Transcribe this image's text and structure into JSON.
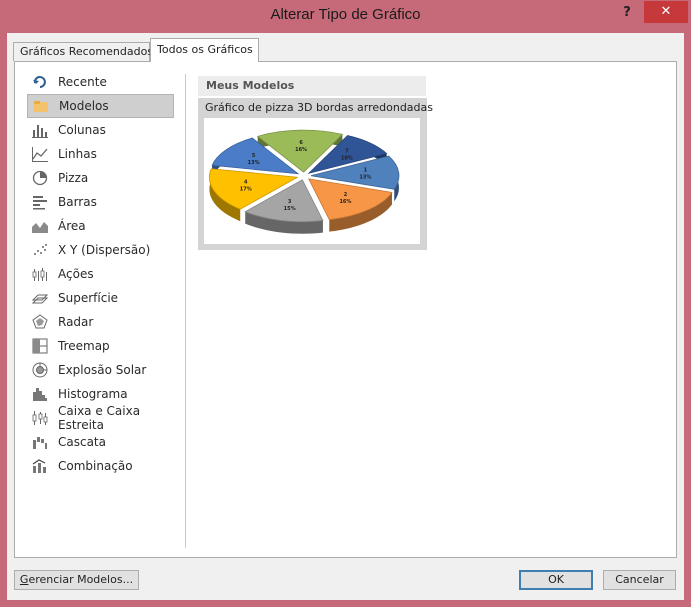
{
  "window": {
    "title": "Alterar Tipo de Gráfico",
    "help_label": "?",
    "close_label": "✕"
  },
  "tabs": [
    {
      "label": "Gráficos Recomendados",
      "active": false
    },
    {
      "label": "Todos os Gráficos",
      "active": true
    }
  ],
  "sidebar": {
    "selected": "Modelos",
    "items": [
      {
        "label": "Recente",
        "icon": "recent-icon"
      },
      {
        "label": "Modelos",
        "icon": "folder-icon"
      },
      {
        "label": "Colunas",
        "icon": "column-chart-icon"
      },
      {
        "label": "Linhas",
        "icon": "line-chart-icon"
      },
      {
        "label": "Pizza",
        "icon": "pie-chart-icon"
      },
      {
        "label": "Barras",
        "icon": "bar-chart-icon"
      },
      {
        "label": "Área",
        "icon": "area-chart-icon"
      },
      {
        "label": "X Y (Dispersão)",
        "icon": "scatter-chart-icon"
      },
      {
        "label": "Ações",
        "icon": "stock-chart-icon"
      },
      {
        "label": "Superfície",
        "icon": "surface-chart-icon"
      },
      {
        "label": "Radar",
        "icon": "radar-chart-icon"
      },
      {
        "label": "Treemap",
        "icon": "treemap-chart-icon"
      },
      {
        "label": "Explosão Solar",
        "icon": "sunburst-chart-icon"
      },
      {
        "label": "Histograma",
        "icon": "histogram-chart-icon"
      },
      {
        "label": "Caixa e Caixa Estreita",
        "icon": "box-whisker-chart-icon"
      },
      {
        "label": "Cascata",
        "icon": "waterfall-chart-icon"
      },
      {
        "label": "Combinação",
        "icon": "combo-chart-icon"
      }
    ]
  },
  "templates": {
    "section_title": "Meus Modelos",
    "items": [
      {
        "title": "Gráfico de pizza 3D bordas arredondadas",
        "preview_slices": [
          {
            "label": "1",
            "percent": "13%",
            "value": 13,
            "color": "#4f81bd"
          },
          {
            "label": "2",
            "percent": "16%",
            "value": 16,
            "color": "#f79646"
          },
          {
            "label": "3",
            "percent": "15%",
            "value": 15,
            "color": "#a5a5a5"
          },
          {
            "label": "4",
            "percent": "17%",
            "value": 17,
            "color": "#ffc000"
          },
          {
            "label": "5",
            "percent": "13%",
            "value": 13,
            "color": "#4a7cc7"
          },
          {
            "label": "6",
            "percent": "16%",
            "value": 16,
            "color": "#9bbb59"
          },
          {
            "label": "7",
            "percent": "10%",
            "value": 10,
            "color": "#2f5597"
          }
        ]
      }
    ]
  },
  "buttons": {
    "manage_mnemonic": "G",
    "manage_rest": "erenciar Modelos...",
    "ok": "OK",
    "cancel": "Cancelar"
  },
  "colors": {
    "window_frame": "#c66a79",
    "close_button": "#c7383b",
    "selection": "#cfcfcf"
  }
}
